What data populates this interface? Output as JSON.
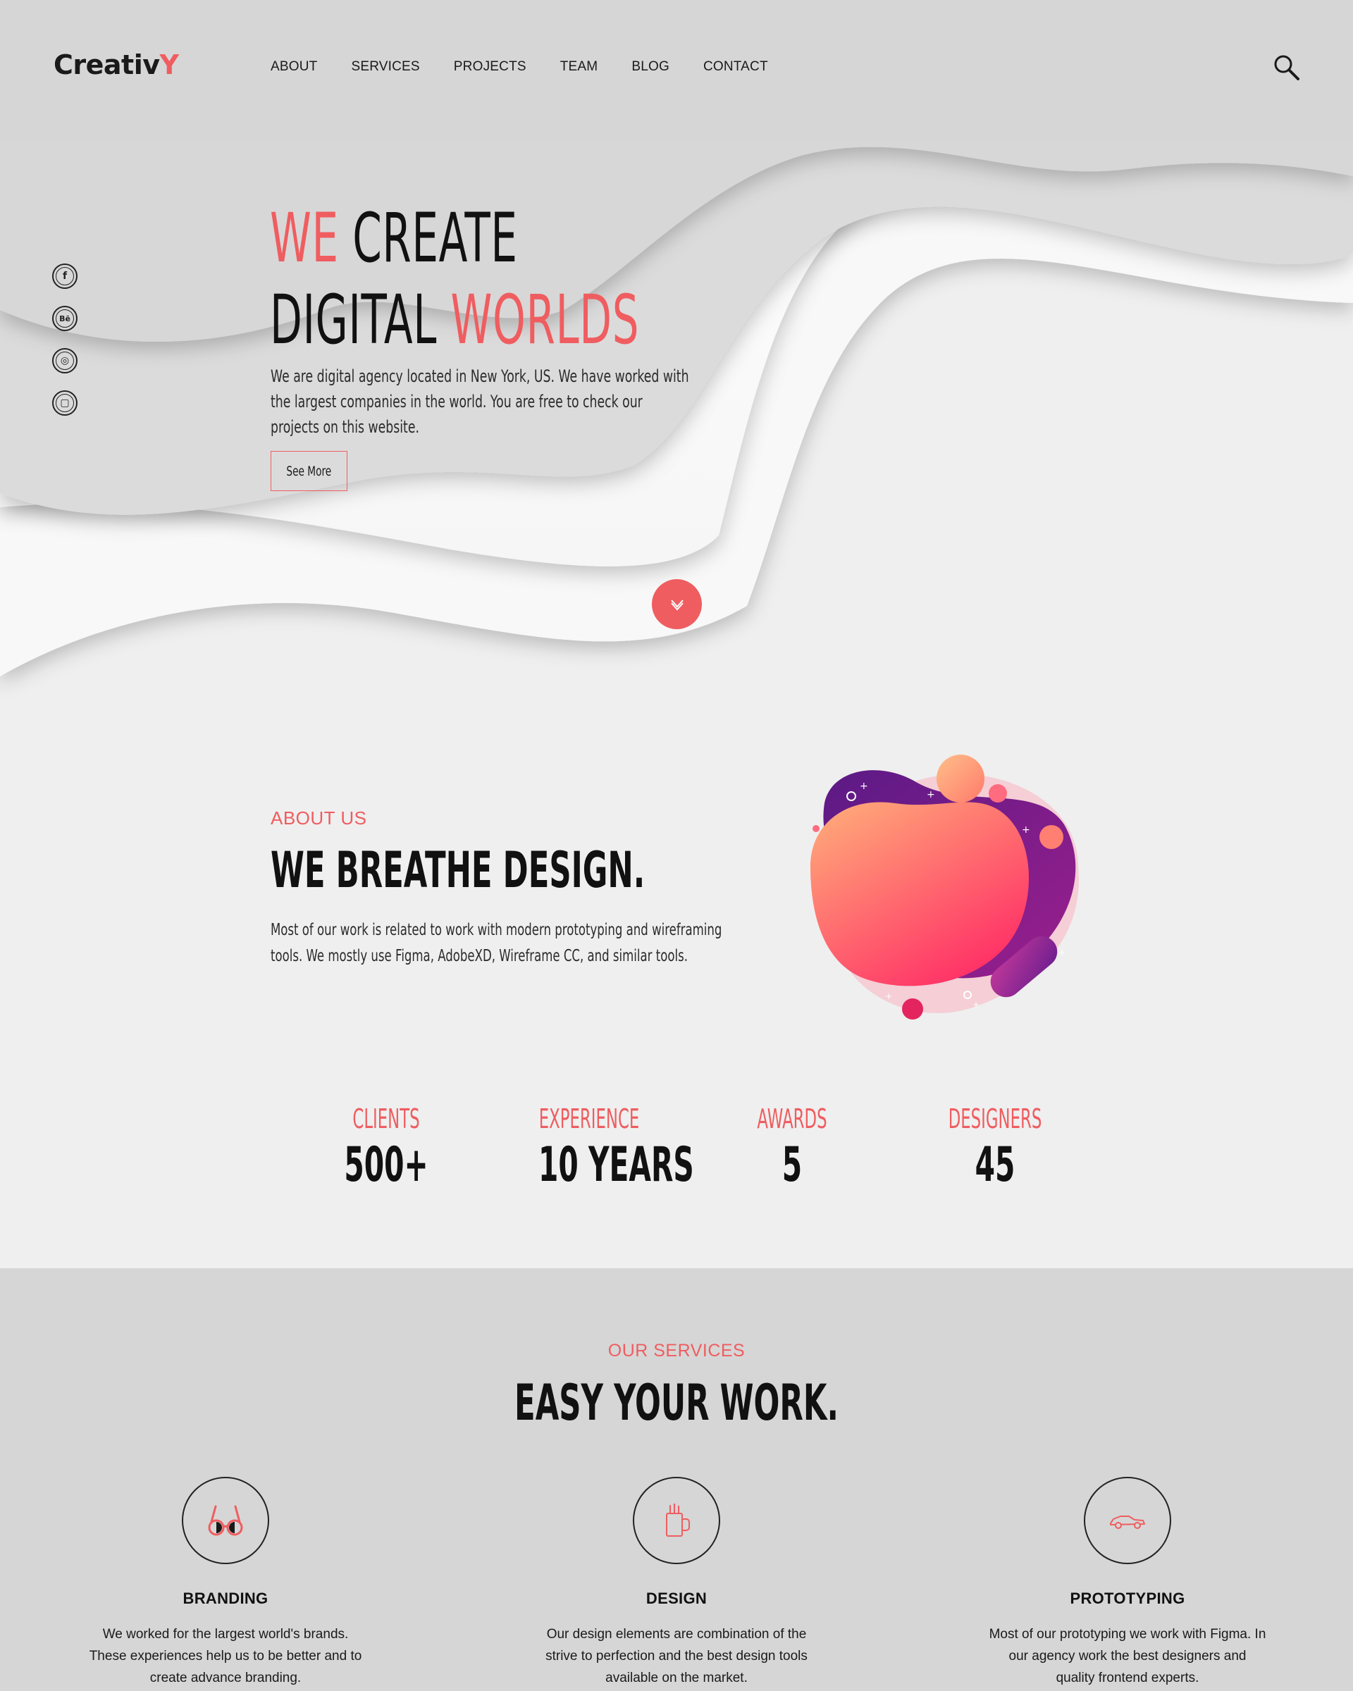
{
  "colors": {
    "accent": "#ef5d60",
    "text": "#151515",
    "hero_bg": "#d6d6d6",
    "page_bg": "#efefef",
    "services_bg": "#d6d6d6"
  },
  "logo": {
    "text": "Creativ",
    "accent_letter": "Y"
  },
  "nav": {
    "items": [
      "ABOUT",
      "SERVICES",
      "PROJECTS",
      "TEAM",
      "BLOG",
      "CONTACT"
    ]
  },
  "header": {
    "search_icon": "magnifier-icon"
  },
  "social": {
    "items": [
      {
        "icon": "facebook-icon",
        "glyph": "f"
      },
      {
        "icon": "behance-icon",
        "glyph": "Bē"
      },
      {
        "icon": "dribbble-icon",
        "glyph": "◎"
      },
      {
        "icon": "instagram-icon",
        "glyph": "▢"
      }
    ]
  },
  "hero": {
    "title_line1_a": "WE",
    "title_line1_b": " CREATE",
    "title_line2_a": "DIGITAL ",
    "title_line2_b": "WORLDS",
    "text_lines": [
      "We are digital agency located in New York, US. We have worked with",
      "the largest companies in the world. You are free to check our",
      "projects on this website."
    ],
    "cta_label": "See More",
    "scroll_icon": "chevron-down-icon"
  },
  "about": {
    "kicker": "ABOUT US",
    "title": "WE BREATHE DESIGN.",
    "text_lines": [
      "Most of our work is related to work with modern prototyping and wireframing",
      "tools. We mostly use Figma, AdobeXD, Wireframe CC, and similar tools."
    ],
    "illustration": "abstract-blob-illustration"
  },
  "stats": [
    {
      "label": "CLIENTS",
      "value": "500+"
    },
    {
      "label": "EXPERIENCE",
      "value": "10 YEARS"
    },
    {
      "label": "AWARDS",
      "value": "5"
    },
    {
      "label": "DESIGNERS",
      "value": "45"
    }
  ],
  "services": {
    "kicker": "OUR SERVICES",
    "title": "EASY YOUR WORK.",
    "items": [
      {
        "name": "BRANDING",
        "icon": "glasses-icon",
        "desc_lines": [
          "We worked for the largest world's brands.",
          "These experiences help us to be better and to",
          "create advance branding."
        ]
      },
      {
        "name": "DESIGN",
        "icon": "pencil-cup-icon",
        "desc_lines": [
          "Our design elements are combination of the",
          "strive to perfection and the best design tools",
          "available on the market."
        ]
      },
      {
        "name": "PROTOTYPING",
        "icon": "car-icon",
        "desc_lines": [
          "Most of our prototyping we work with Figma. In",
          "our agency work the best designers and",
          "quality frontend experts."
        ]
      }
    ]
  }
}
